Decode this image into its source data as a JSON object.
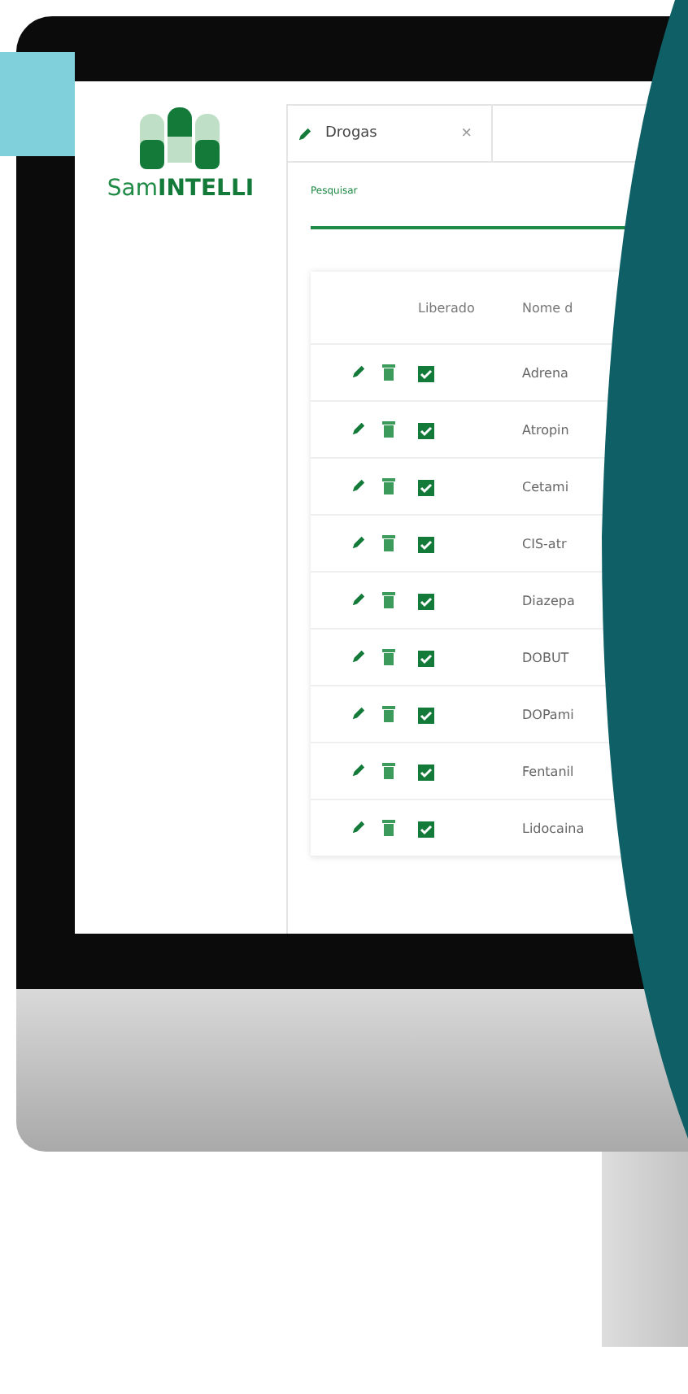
{
  "logo": {
    "text": "Sam**INTELLI**"
  },
  "tabs": [
    {
      "label": "Drogas",
      "close": "×",
      "selected": true
    }
  ],
  "search": {
    "label": "Pesquisar"
  },
  "table": {
    "columns": [
      "Liberado",
      "Nome d"
    ],
    "rows": [
      {
        "name": "Adrena",
        "released": true
      },
      {
        "name": "Atropin",
        "released": true
      },
      {
        "name": "Cetami",
        "released": true
      },
      {
        "name": "CIS-atr",
        "released": true
      },
      {
        "name": "Diazepa",
        "released": true
      },
      {
        "name": "DOBUT",
        "released": true
      },
      {
        "name": "DOPami",
        "released": true
      },
      {
        "name": "Fentanil",
        "released": true
      },
      {
        "name": "Lidocaina",
        "released": true
      }
    ]
  }
}
